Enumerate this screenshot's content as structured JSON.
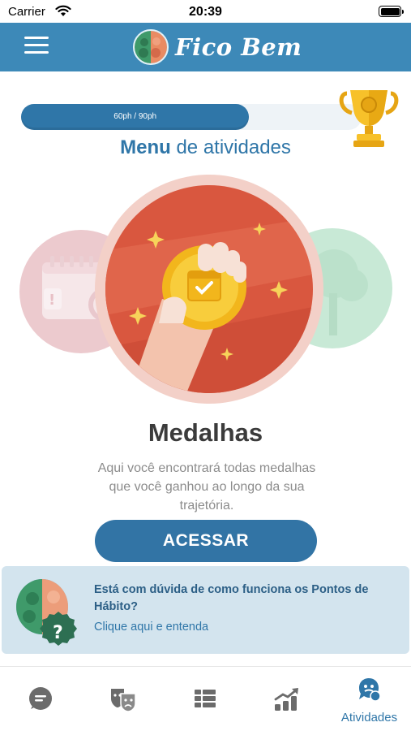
{
  "status_bar": {
    "carrier": "Carrier",
    "time": "20:39"
  },
  "header": {
    "app_name": "Fico Bem"
  },
  "progress": {
    "text": "60ph / 90ph",
    "current": 60,
    "goal": 90
  },
  "menu_title": {
    "bold": "Menu",
    "rest": " de atividades"
  },
  "activity": {
    "title": "Medalhas",
    "description": "Aqui você encontrará todas medalhas que você ganhou ao longo da sua trajetória.",
    "button": "ACESSAR"
  },
  "help": {
    "question": "Está com dúvida de como funciona os Pontos de Hábito?",
    "link": "Clique aqui e entenda"
  },
  "tabs": [
    {
      "icon": "chat-icon",
      "label": ""
    },
    {
      "icon": "theater-masks-icon",
      "label": ""
    },
    {
      "icon": "list-grid-icon",
      "label": ""
    },
    {
      "icon": "growth-chart-icon",
      "label": ""
    },
    {
      "icon": "activities-icon",
      "label": "Atividades",
      "active": true
    }
  ],
  "colors": {
    "primary": "#3d89b8",
    "button": "#3274a5",
    "medal_circle": "#d9573f",
    "help_card": "#d3e4ee"
  }
}
